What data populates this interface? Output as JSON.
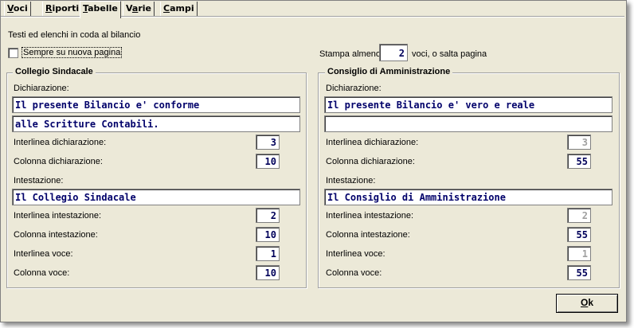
{
  "tabs": {
    "voci": {
      "accel": "V",
      "rest": "oci"
    },
    "riporti": {
      "accel": "R",
      "rest": "iporti"
    },
    "tabelle": {
      "accel": "T",
      "rest": "abelle"
    },
    "varie": {
      "pre": "V",
      "accel": "a",
      "rest": "rie"
    },
    "campi": {
      "accel": "C",
      "rest": "ampi"
    }
  },
  "header": {
    "title": "Testi ed elenchi in coda al bilancio",
    "new_page_label": "Sempre su nuova pagina",
    "print_min_label": "Stampa almeno",
    "print_min_value": "2",
    "print_min_suffix": "voci, o salta pagina"
  },
  "collegio": {
    "title": "Collegio Sindacale",
    "dichiarazione_label": "Dichiarazione:",
    "dichiarazione_line1": "Il presente Bilancio e' conforme",
    "dichiarazione_line2": "alle Scritture Contabili.",
    "interlinea_dich_label": "Interlinea dichiarazione:",
    "interlinea_dich_value": "3",
    "colonna_dich_label": "Colonna dichiarazione:",
    "colonna_dich_value": "10",
    "intestazione_label": "Intestazione:",
    "intestazione_value": "Il Collegio Sindacale",
    "interlinea_int_label": "Interlinea intestazione:",
    "interlinea_int_value": "2",
    "colonna_int_label": "Colonna intestazione:",
    "colonna_int_value": "10",
    "interlinea_voce_label": "Interlinea voce:",
    "interlinea_voce_value": "1",
    "colonna_voce_label": "Colonna voce:",
    "colonna_voce_value": "10"
  },
  "consiglio": {
    "title": "Consiglio di Amministrazione",
    "dichiarazione_label": "Dichiarazione:",
    "dichiarazione_line1": "Il presente Bilancio e' vero e reale",
    "dichiarazione_line2": "",
    "interlinea_dich_label": "Interlinea dichiarazione:",
    "interlinea_dich_value": "3",
    "colonna_dich_label": "Colonna dichiarazione:",
    "colonna_dich_value": "55",
    "intestazione_label": "Intestazione:",
    "intestazione_value": "Il Consiglio di Amministrazione",
    "interlinea_int_label": "Interlinea intestazione:",
    "interlinea_int_value": "2",
    "colonna_int_label": "Colonna intestazione:",
    "colonna_int_value": "55",
    "interlinea_voce_label": "Interlinea voce:",
    "interlinea_voce_value": "1",
    "colonna_voce_label": "Colonna voce:",
    "colonna_voce_value": "55"
  },
  "ok_button": {
    "accel": "O",
    "rest": "k"
  }
}
